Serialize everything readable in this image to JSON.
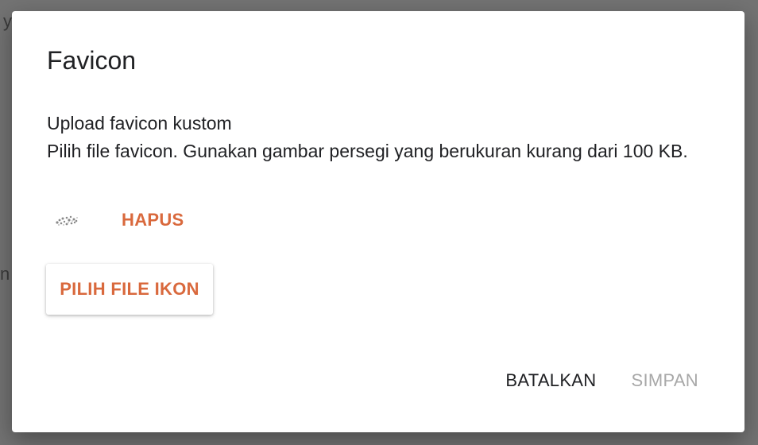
{
  "background": {
    "fragment_top": "y",
    "fragment_mid": "n b"
  },
  "dialog": {
    "title": "Favicon",
    "heading": "Upload favicon kustom",
    "description": "Pilih file favicon. Gunakan gambar persegi yang berukuran kurang dari 100 KB.",
    "remove_label": "HAPUS",
    "choose_label": "PILIH FILE IKON",
    "cancel_label": "BATALKAN",
    "save_label": "SIMPAN"
  },
  "colors": {
    "accent": "#d9693d",
    "text": "#202124",
    "disabled": "#a8a8a8",
    "overlay": "#737373"
  }
}
